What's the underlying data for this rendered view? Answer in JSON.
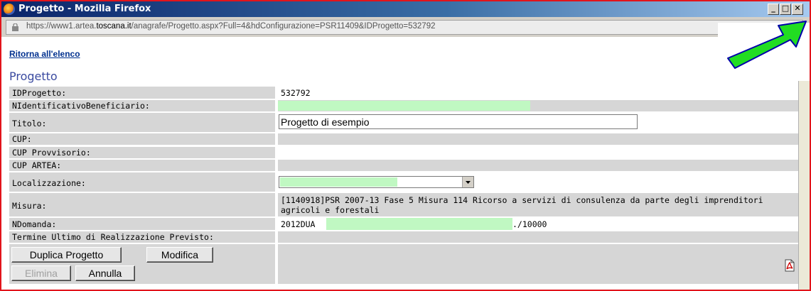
{
  "window": {
    "title": "Progetto - Mozilla Firefox"
  },
  "browser": {
    "url_prefix": "https://www1.artea.",
    "url_domain": "toscana.it",
    "url_path": "/anagrafe/Progetto.aspx?Full=4&hdConfigurazione=PSR11409&IDProgetto=532792"
  },
  "nav": {
    "back_link": "Ritorna all'elenco"
  },
  "page": {
    "title": "Progetto"
  },
  "form": {
    "id_label": "IDProgetto:",
    "id_value": "532792",
    "ben_label": "NIdentificativoBeneficiario:",
    "titolo_label": "Titolo:",
    "titolo_value": "Progetto di esempio",
    "cup_label": "CUP:",
    "cup_prov_label": "CUP Provvisorio:",
    "cup_artea_label": "CUP ARTEA:",
    "loc_label": "Localizzazione:",
    "misura_label": "Misura:",
    "misura_line1": "[1140918]PSR 2007-13 Fase 5 Misura 114 Ricorso a servizi di consulenza da parte degli imprenditori",
    "misura_line2": "agricoli e forestali",
    "ndom_label": "NDomanda:",
    "ndom_prefix": "2012DUA",
    "ndom_suffix": "./10000",
    "termine_label": "Termine Ultimo di Realizzazione Previsto:"
  },
  "buttons": {
    "duplica": "Duplica Progetto",
    "modifica": "Modifica",
    "elimina": "Elimina",
    "annulla": "Annulla"
  },
  "colors": {
    "highlight_green": "#c0f8c2",
    "arrow_green": "#22dd22",
    "frame_red": "#e2141b"
  }
}
